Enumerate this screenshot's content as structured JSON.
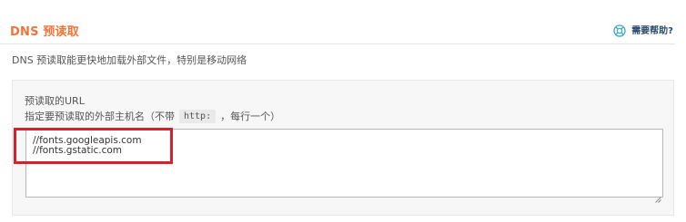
{
  "header": {
    "title": "DNS 预读取",
    "help_label": "需要帮助?",
    "help_icon": "lifebuoy-icon"
  },
  "description": "DNS 预读取能更快地加载外部文件，特别是移动网络",
  "field": {
    "label": "预读取的URL",
    "hint_before": "指定要预读取的外部主机名（不带",
    "hint_code": "http:",
    "hint_after": "，每行一个）",
    "value": "//fonts.googleapis.com\n//fonts.gstatic.com"
  },
  "colors": {
    "title": "#f0753a",
    "help_text": "#2b4a6b",
    "help_icon": "#3ea8c4",
    "highlight": "#d6202a"
  }
}
